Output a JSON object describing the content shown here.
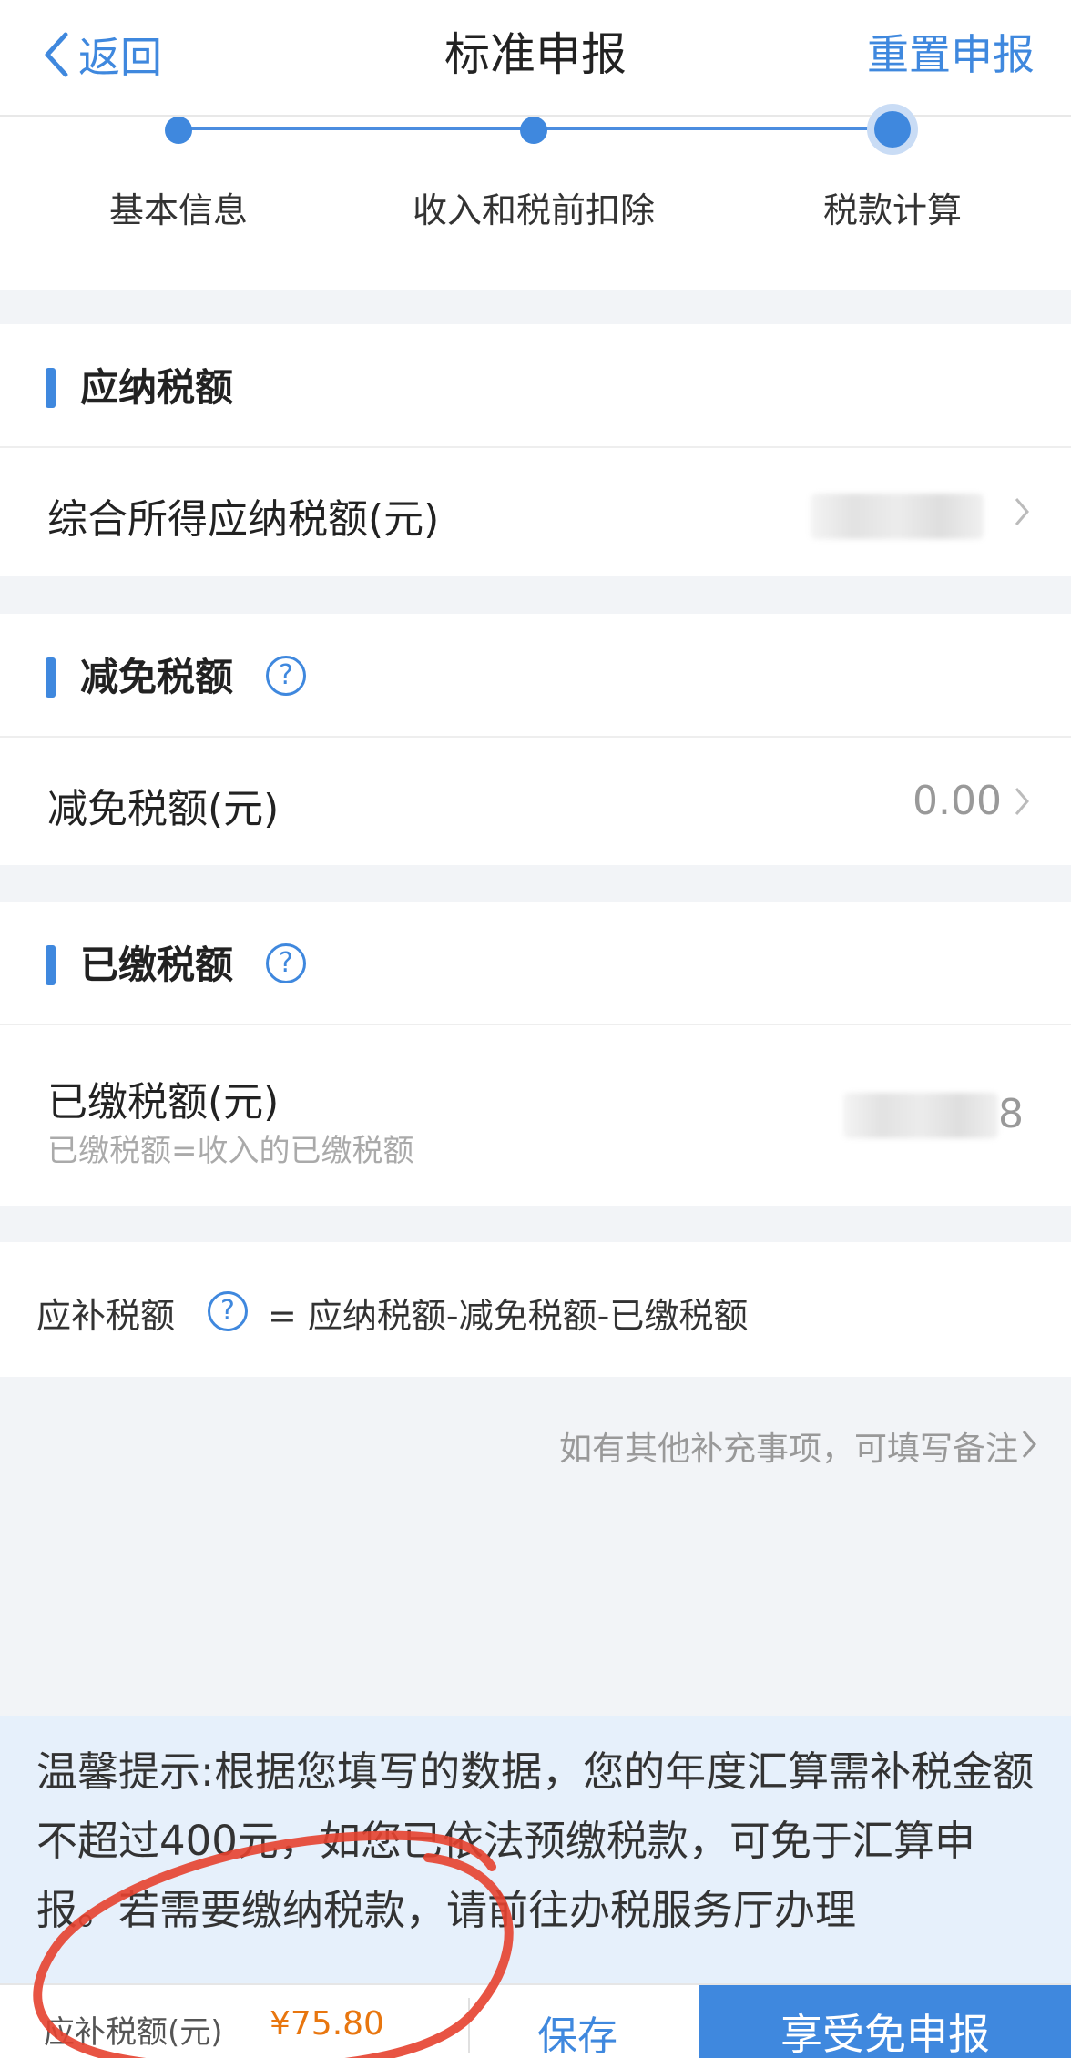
{
  "header": {
    "back_label": "返回",
    "title": "标准申报",
    "reset_label": "重置申报"
  },
  "steps": [
    {
      "label": "基本信息",
      "state": "done"
    },
    {
      "label": "收入和税前扣除",
      "state": "done"
    },
    {
      "label": "税款计算",
      "state": "active"
    }
  ],
  "sections": {
    "payable": {
      "title": "应纳税额",
      "row_label": "综合所得应纳税额(元)",
      "row_value_obscured": true
    },
    "reduction": {
      "title": "减免税额",
      "row_label": "减免税额(元)",
      "row_value": "0.00"
    },
    "paid": {
      "title": "已缴税额",
      "row_label": "已缴税额(元)",
      "row_sub": "已缴税额=收入的已缴税额",
      "row_value_visible": "8"
    }
  },
  "formula": {
    "label": "应补税额",
    "text": "= 应纳税额-减免税额-已缴税额"
  },
  "remark": {
    "label": "如有其他补充事项，可填写备注"
  },
  "tip": {
    "text": "温馨提示:根据您填写的数据，您的年度汇算需补税金额不超过400元，如您已依法预缴税款，可免于汇算申报。若需要缴纳税款，请前往办税服务厅办理"
  },
  "footer": {
    "due_label": "应补税额(元)",
    "due_value": "¥75.80",
    "save_label": "保存",
    "exempt_label": "享受免申报"
  },
  "colors": {
    "accent": "#3f88de",
    "amount": "#e8760f",
    "background": "#f2f4f7",
    "tip_background": "#e6f0fb",
    "annotation": "#e5412f"
  }
}
